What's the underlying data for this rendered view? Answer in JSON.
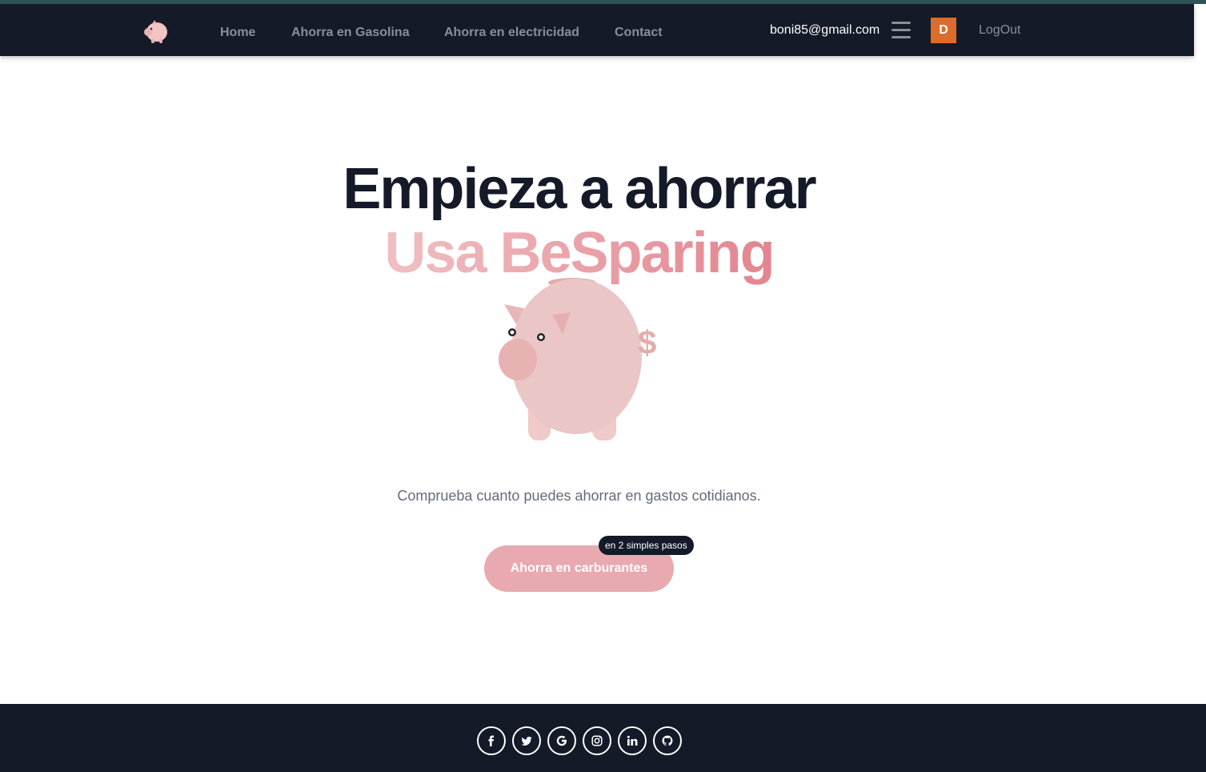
{
  "nav": {
    "links": [
      "Home",
      "Ahorra en Gasolina",
      "Ahorra en electricidad",
      "Contact"
    ],
    "email": "boni85@gmail.com",
    "avatar_letter": "D",
    "logout": "LogOut"
  },
  "hero": {
    "title": "Empieza a ahorrar",
    "subtitle": "Usa BeSparing",
    "description": "Comprueba cuanto puedes ahorrar en gastos cotidianos.",
    "cta_label": "Ahorra en carburantes",
    "cta_badge": "en 2 simples pasos"
  },
  "footer": {
    "social_icons": [
      "facebook-icon",
      "twitter-icon",
      "google-icon",
      "instagram-icon",
      "linkedin-icon",
      "github-icon"
    ]
  },
  "colors": {
    "navbar": "#151a29",
    "accent_pink": "#e8a9b0",
    "avatar": "#dd6b2b",
    "top_strip": "#2f5458"
  }
}
